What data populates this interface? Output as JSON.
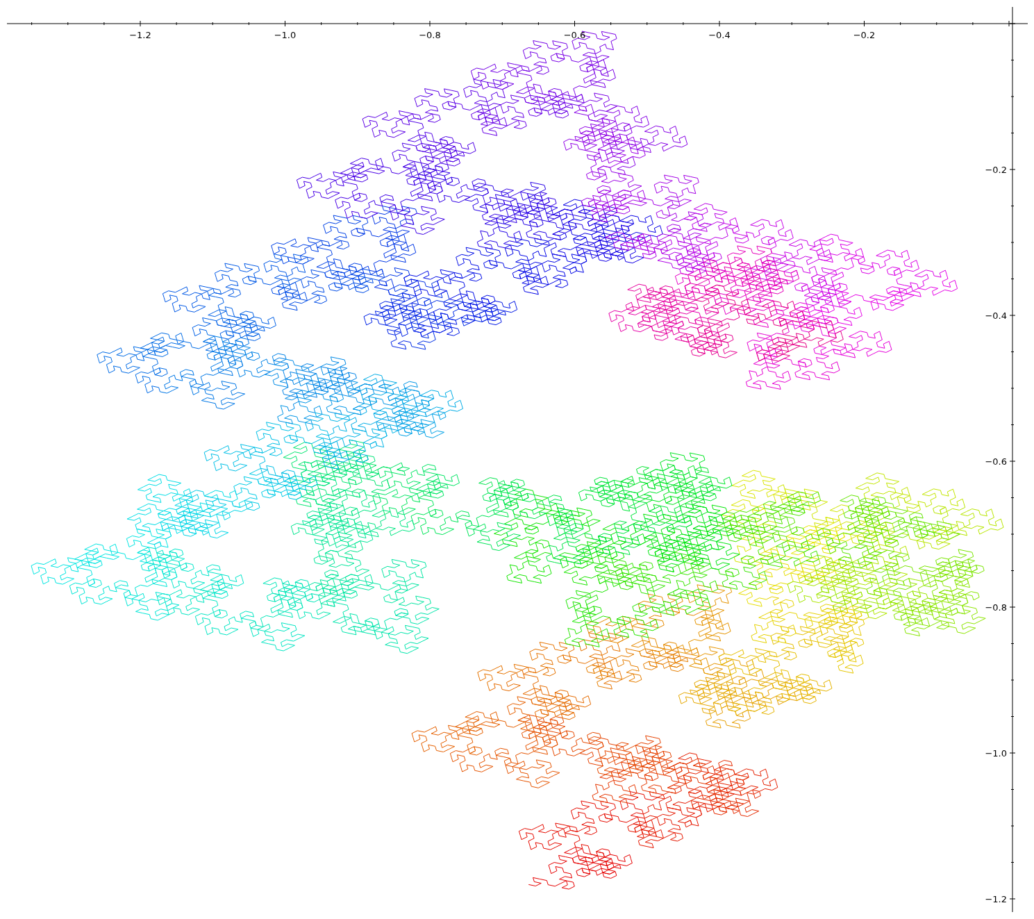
{
  "plot": {
    "x_axis": {
      "ticks": [
        "−1.2",
        "−1.0",
        "−0.8",
        "−0.6",
        "−0.4",
        "−0.2"
      ]
    },
    "y_axis": {
      "ticks": [
        "−0.2",
        "−0.4",
        "−0.6",
        "−0.8",
        "−1.0",
        "−1.2"
      ]
    }
  }
}
